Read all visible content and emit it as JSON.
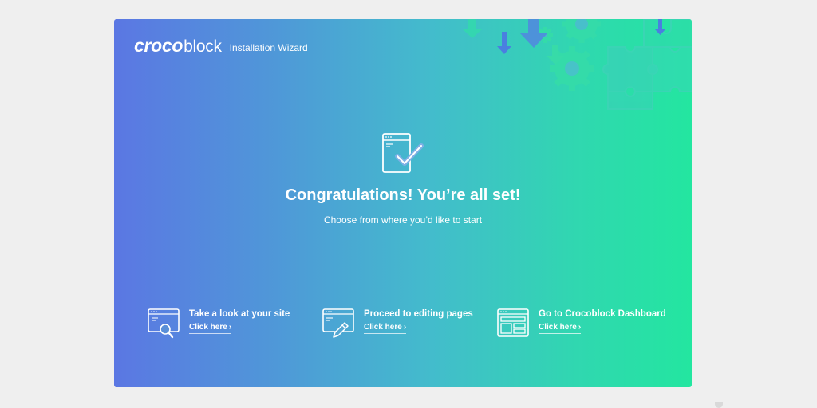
{
  "header": {
    "logo_bold": "croco",
    "logo_light": "block",
    "wizard_title": "Installation Wizard"
  },
  "hero": {
    "title": "Congratulations! You’re all set!",
    "subtitle": "Choose from where you’d like to start",
    "icon": "browser-checkmark-icon"
  },
  "actions": [
    {
      "title": "Take a look at your site",
      "link": "Click here",
      "chevron": "›",
      "icon": "browser-magnifier-icon"
    },
    {
      "title": "Proceed to editing pages",
      "link": "Click here",
      "chevron": "›",
      "icon": "browser-pencil-icon"
    },
    {
      "title": "Go to Crocoblock Dashboard",
      "link": "Click here",
      "chevron": "›",
      "icon": "browser-dashboard-icon"
    }
  ],
  "colors": {
    "gradient_start": "#5b77e3",
    "gradient_end": "#23e6a0",
    "page_bg": "#efefef",
    "text": "#ffffff"
  }
}
